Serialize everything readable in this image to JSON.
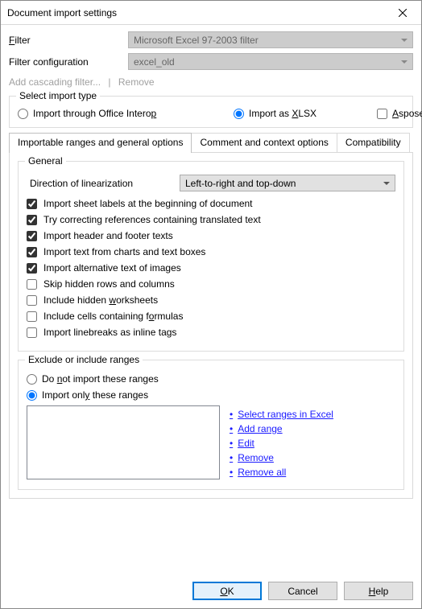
{
  "window": {
    "title": "Document import settings"
  },
  "form": {
    "filter_label": "Filter",
    "filter_value": "Microsoft Excel 97-2003 filter",
    "filter_config_label": "Filter configuration",
    "filter_config_value": "excel_old",
    "add_cascading": "Add cascading filter...",
    "remove_cascading": "Remove"
  },
  "import_type": {
    "legend": "Select import type",
    "office_interop": "Import through Office Interop",
    "import_as_xlsx": "Import as XLSX",
    "aspose": "Aspose"
  },
  "tabs": {
    "t1": "Importable ranges and general options",
    "t2": "Comment and context options",
    "t3": "Compatibility"
  },
  "general": {
    "legend": "General",
    "direction_label": "Direction of linearization",
    "direction_value": "Left-to-right and top-down",
    "c1": "Import sheet labels at the beginning of document",
    "c2": "Try correcting references containing translated text",
    "c3": "Import header and footer texts",
    "c4": "Import text from charts and text boxes",
    "c5": "Import alternative text of images",
    "c6": "Skip hidden rows and columns",
    "c7": "Include hidden worksheets",
    "c8": "Include cells containing formulas",
    "c9": "Import linebreaks as inline tags"
  },
  "ranges": {
    "legend": "Exclude or include ranges",
    "r1": "Do not import these ranges",
    "r2": "Import only these ranges",
    "a1": "Select ranges in Excel",
    "a2": "Add range",
    "a3": "Edit",
    "a4": "Remove",
    "a5": "Remove all"
  },
  "buttons": {
    "ok": "OK",
    "cancel": "Cancel",
    "help": "Help"
  }
}
